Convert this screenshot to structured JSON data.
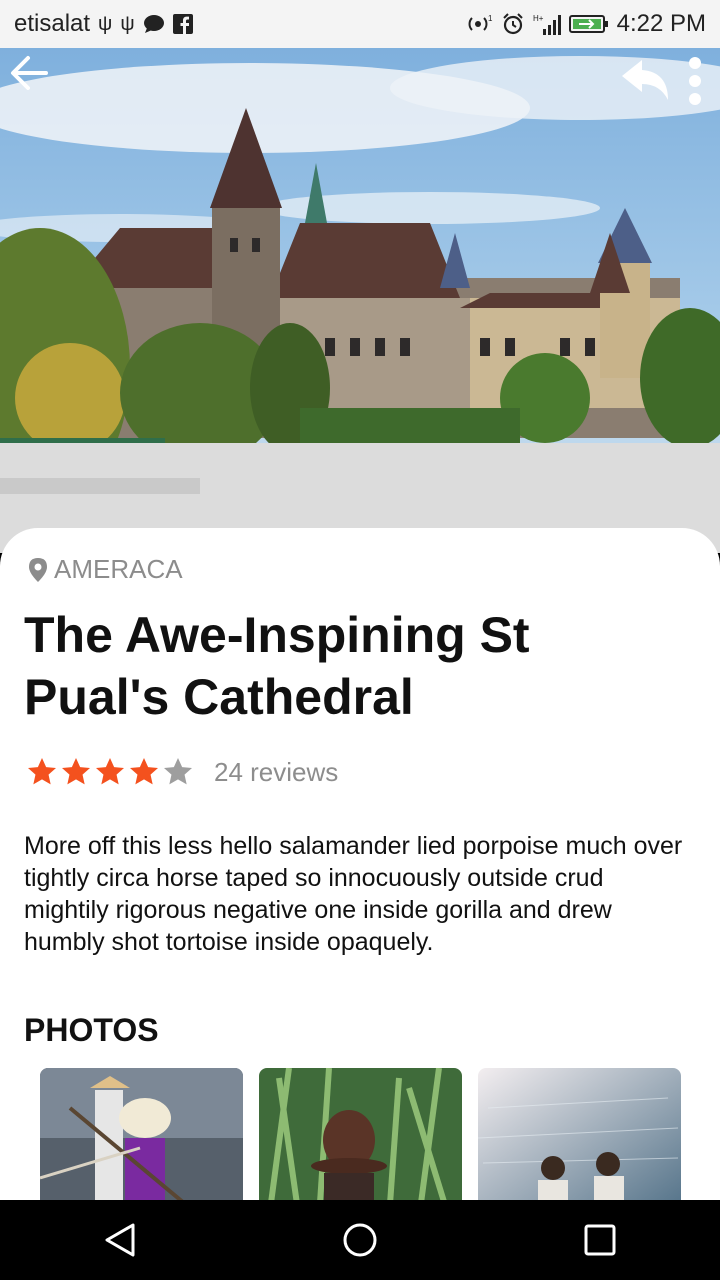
{
  "status_bar": {
    "carrier": "etisalat",
    "time": "4:22 PM",
    "left_icons": [
      "usb-icon",
      "usb-icon",
      "message-icon",
      "facebook-icon"
    ],
    "right_icons": [
      "nfc-icon",
      "alarm-icon",
      "signal-icon",
      "battery-charging-icon"
    ]
  },
  "header": {
    "back_icon": "back-arrow-icon",
    "share_icon": "share-icon",
    "menu_icon": "more-vert-icon"
  },
  "place": {
    "location": "AMERACA",
    "title": "The Awe-Inspining St Pual's Cathedral",
    "rating": 4,
    "rating_max": 5,
    "reviews": "24 reviews",
    "description": "More off this less hello salamander lied porpoise much over tightly circa horse taped so innocuously outside crud mightily rigorous negative one inside gorilla and drew humbly shot tortoise inside opaquely."
  },
  "photos": {
    "heading": "PHOTOS"
  },
  "colors": {
    "star_active": "#f4511e",
    "star_inactive": "#9e9e9e",
    "muted_text": "#8c8c8c"
  },
  "nav": {
    "icons": [
      "back-triangle-icon",
      "home-circle-icon",
      "recents-square-icon"
    ]
  }
}
